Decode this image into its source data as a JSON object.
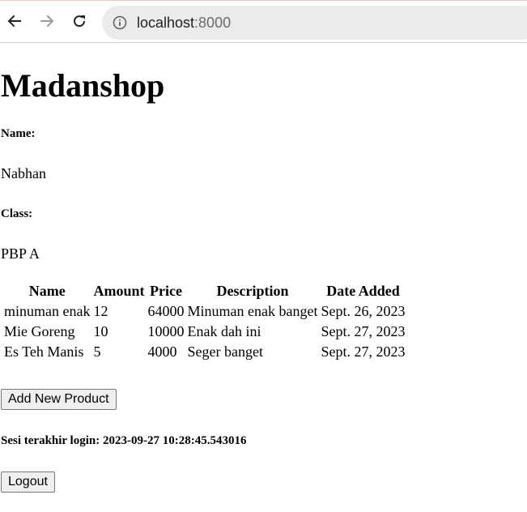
{
  "browser": {
    "url_host": "localhost",
    "url_port": ":8000"
  },
  "page": {
    "title": "Madanshop",
    "name_label": "Name:",
    "name_value": "Nabhan",
    "class_label": "Class:",
    "class_value": "PBP A"
  },
  "table": {
    "headers": [
      "Name",
      "Amount",
      "Price",
      "Description",
      "Date Added"
    ],
    "rows": [
      [
        "minuman enak",
        "12",
        "64000",
        "Minuman enak banget",
        "Sept. 26, 2023"
      ],
      [
        "Mie Goreng",
        "10",
        "10000",
        "Enak dah ini",
        "Sept. 27, 2023"
      ],
      [
        "Es Teh Manis",
        "5",
        "4000",
        "Seger banget",
        "Sept. 27, 2023"
      ]
    ]
  },
  "actions": {
    "add_product_label": "Add New Product",
    "last_login_text": "Sesi terakhir login: 2023-09-27 10:28:45.543016",
    "logout_label": "Logout"
  }
}
